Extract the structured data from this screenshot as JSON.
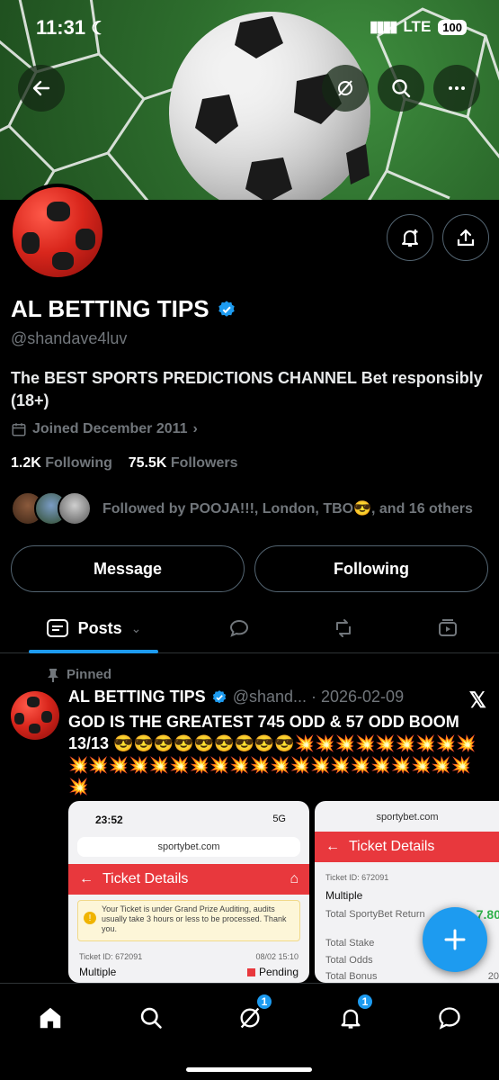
{
  "status_bar": {
    "time": "11:31",
    "network": "LTE",
    "battery": "100"
  },
  "profile": {
    "name": "AL BETTING TIPS",
    "handle": "@shandave4luv",
    "bio": "The BEST SPORTS PREDICTIONS CHANNEL Bet responsibly (18+)",
    "joined": "Joined December 2011",
    "following_count": "1.2K",
    "following_label": "Following",
    "followers_count": "75.5K",
    "followers_label": "Followers",
    "followed_by": "Followed by POOJA!!!, London, TBO😎, and 16 others"
  },
  "actions": {
    "message_label": "Message",
    "following_label": "Following"
  },
  "tabs": {
    "posts_label": "Posts"
  },
  "post": {
    "pinned_label": "Pinned",
    "author": "AL BETTING TIPS",
    "meta": "@shand... · 2026-02-09",
    "text": "GOD IS THE GREATEST 745 ODD & 57 ODD BOOM 13/13 😎😎😎😎😎😎😎😎😎💥💥💥💥💥💥💥💥💥💥💥💥💥💥💥💥💥💥💥💥💥💥💥💥💥💥💥💥💥💥",
    "x_logo": "𝕏",
    "screenshot1": {
      "time": "23:52",
      "signal": "5G",
      "url": "sportybet.com",
      "header": "Ticket Details",
      "notice": "Your Ticket is under Grand Prize Auditing, audits usually take 3 hours or less to be processed. Thank you.",
      "ticket_id": "Ticket ID: 672091",
      "date": "08/02 15:10",
      "type": "Multiple",
      "status": "Pending"
    },
    "screenshot2": {
      "url": "sportybet.com",
      "header": "Ticket Details",
      "ticket_id": "Ticket ID: 672091",
      "type": "Multiple",
      "return_label": "Total SportyBet Return",
      "return_value": "7.80",
      "stake_label": "Total Stake",
      "odds_label": "Total Odds",
      "bonus_label": "Total Bonus",
      "bonus_value": "20"
    }
  },
  "nav": {
    "messages_badge": "1",
    "notifications_badge": "1"
  },
  "colors": {
    "accent": "#1d9bf0",
    "sporty_red": "#e8383d",
    "background": "#000000"
  }
}
